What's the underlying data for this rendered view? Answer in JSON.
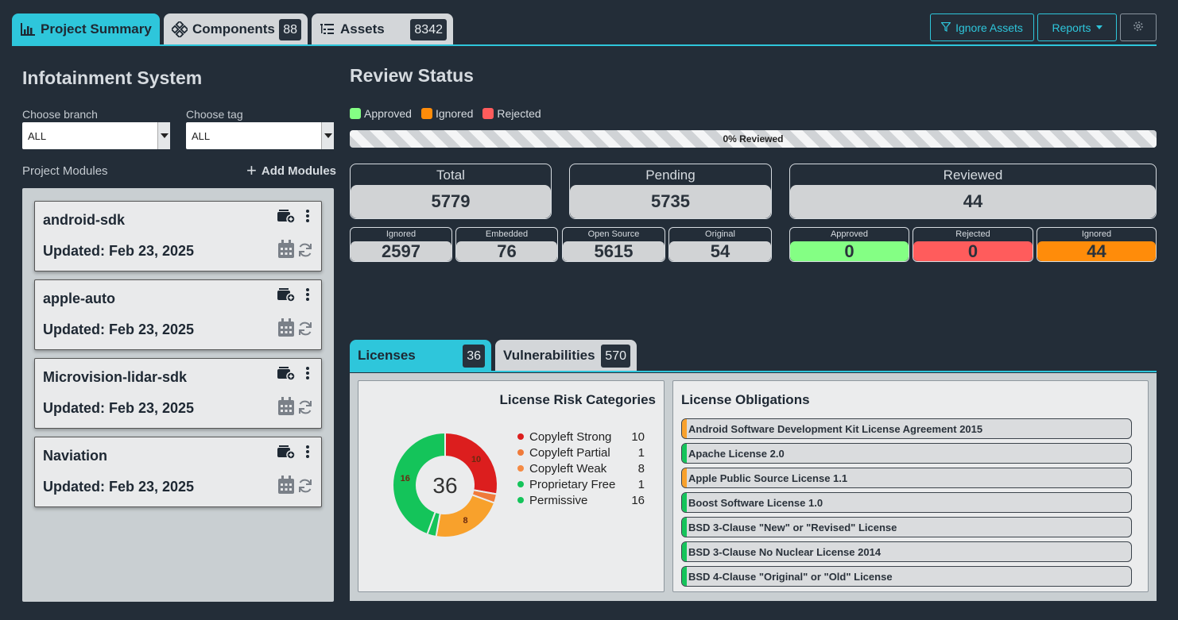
{
  "tabs": {
    "project_summary": "Project Summary",
    "components": "Components",
    "components_count": "88",
    "assets": "Assets",
    "assets_count": "8342"
  },
  "toolbar": {
    "ignore_assets": "Ignore Assets",
    "reports": "Reports"
  },
  "project": {
    "title": "Infotainment System",
    "branch_label": "Choose branch",
    "branch_value": "ALL",
    "tag_label": "Choose tag",
    "tag_value": "ALL",
    "modules_label": "Project Modules",
    "add_modules": "Add Modules",
    "modules": [
      {
        "name": "android-sdk",
        "updated": "Updated: Feb 23, 2025"
      },
      {
        "name": "apple-auto",
        "updated": "Updated: Feb 23, 2025"
      },
      {
        "name": "Microvision-lidar-sdk",
        "updated": "Updated: Feb 23, 2025"
      },
      {
        "name": "Naviation",
        "updated": "Updated: Feb 23, 2025"
      }
    ]
  },
  "review": {
    "title": "Review Status",
    "legend": {
      "approved": "Approved",
      "ignored": "Ignored",
      "rejected": "Rejected"
    },
    "colors": {
      "approved": "#84ff84",
      "ignored": "#ff8c0a",
      "rejected": "#ff5c5c"
    },
    "progress_text": "0% Reviewed",
    "progress_fraction": 0,
    "total_label": "Total",
    "total": "5779",
    "pending_label": "Pending",
    "pending": "5735",
    "reviewed_label": "Reviewed",
    "reviewed": "44",
    "ignored_label": "Ignored",
    "ignored": "2597",
    "embedded_label": "Embedded",
    "embedded": "76",
    "opensource_label": "Open Source",
    "opensource": "5615",
    "original_label": "Original",
    "original": "54",
    "approved_label": "Approved",
    "approved_count": "0",
    "rejected_label": "Rejected",
    "rejected_count": "0",
    "ignored2_label": "Ignored",
    "ignored2_count": "44"
  },
  "bottom_tabs": {
    "licenses": "Licenses",
    "licenses_count": "36",
    "vulnerabilities": "Vulnerabilities",
    "vulnerabilities_count": "570"
  },
  "risk": {
    "title": "License Risk Categories",
    "total": "36",
    "categories": [
      {
        "name": "Copyleft Strong",
        "count": "10",
        "color": "#dc1e1e"
      },
      {
        "name": "Copyleft Partial",
        "count": "1",
        "color": "#f07a3a"
      },
      {
        "name": "Copyleft Weak",
        "count": "8",
        "color": "#f8a12c"
      },
      {
        "name": "Proprietary Free",
        "count": "1",
        "color": "#14c45a"
      },
      {
        "name": "Permissive",
        "count": "16",
        "color": "#14c45a"
      }
    ]
  },
  "chart_data": {
    "type": "pie",
    "categories": [
      "Copyleft Strong",
      "Copyleft Partial",
      "Copyleft Weak",
      "Proprietary Free",
      "Permissive"
    ],
    "values": [
      10,
      1,
      8,
      1,
      16
    ],
    "title": "License Risk Categories",
    "center_label": "36",
    "data_labels": [
      "10",
      "",
      "8",
      "",
      "16"
    ]
  },
  "obligations": {
    "title": "License Obligations",
    "items": [
      {
        "name": "Android Software Development Kit License Agreement 2015",
        "color": "#f8a12c"
      },
      {
        "name": "Apache License 2.0",
        "color": "#14c45a"
      },
      {
        "name": "Apple Public Source License 1.1",
        "color": "#f8a12c"
      },
      {
        "name": "Boost Software License 1.0",
        "color": "#14c45a"
      },
      {
        "name": "BSD 3-Clause \"New\" or \"Revised\" License",
        "color": "#14c45a"
      },
      {
        "name": "BSD 3-Clause No Nuclear License 2014",
        "color": "#14c45a"
      },
      {
        "name": "BSD 4-Clause \"Original\" or \"Old\" License",
        "color": "#14c45a"
      }
    ]
  }
}
